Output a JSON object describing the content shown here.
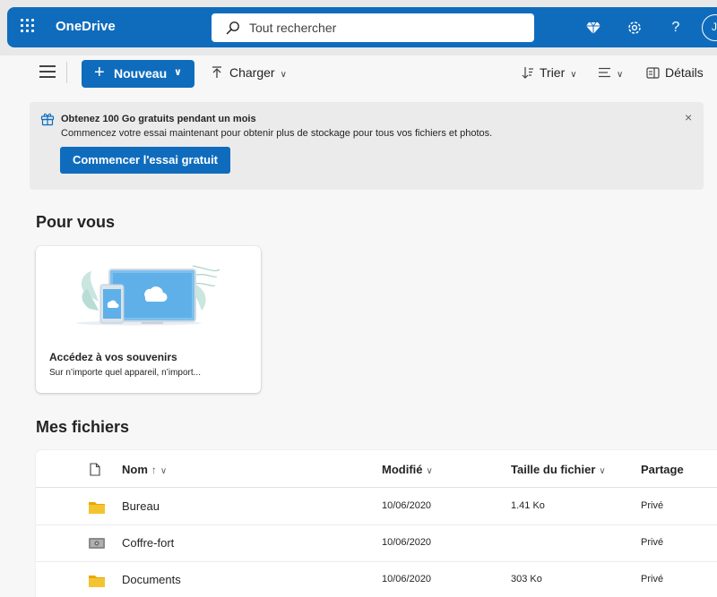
{
  "app": {
    "title": "OneDrive"
  },
  "search": {
    "placeholder": "Tout rechercher"
  },
  "header": {
    "icons": [
      "diamond-icon",
      "gear-icon",
      "help-icon"
    ],
    "help_glyph": "?",
    "avatar_initial": "J"
  },
  "toolbar": {
    "new_label": "Nouveau",
    "upload_label": "Charger",
    "sort_label": "Trier",
    "details_label": "Détails"
  },
  "banner": {
    "title": "Obtenez 100 Go gratuits pendant un mois",
    "text": "Commencez votre essai maintenant pour obtenir plus de stockage pour tous vos fichiers et photos.",
    "button_label": "Commencer l'essai gratuit",
    "close_glyph": "×"
  },
  "for_you": {
    "heading": "Pour vous",
    "card": {
      "title": "Accédez à vos souvenirs",
      "subtitle": "Sur n’importe quel appareil, n’import..."
    }
  },
  "files": {
    "heading": "Mes fichiers",
    "columns": {
      "name": "Nom",
      "modified": "Modifié",
      "size": "Taille du fichier",
      "sharing": "Partage"
    },
    "rows": [
      {
        "icon": "folder-icon",
        "name": "Bureau",
        "modified": "10/06/2020",
        "size": "1.41 Ko",
        "sharing": "Privé"
      },
      {
        "icon": "vault-icon",
        "name": "Coffre-fort",
        "modified": "10/06/2020",
        "size": "",
        "sharing": "Privé"
      },
      {
        "icon": "folder-icon",
        "name": "Documents",
        "modified": "10/06/2020",
        "size": "303 Ko",
        "sharing": "Privé"
      }
    ]
  },
  "colors": {
    "brand": "#0f6cbd",
    "folder": "#f4c430"
  }
}
